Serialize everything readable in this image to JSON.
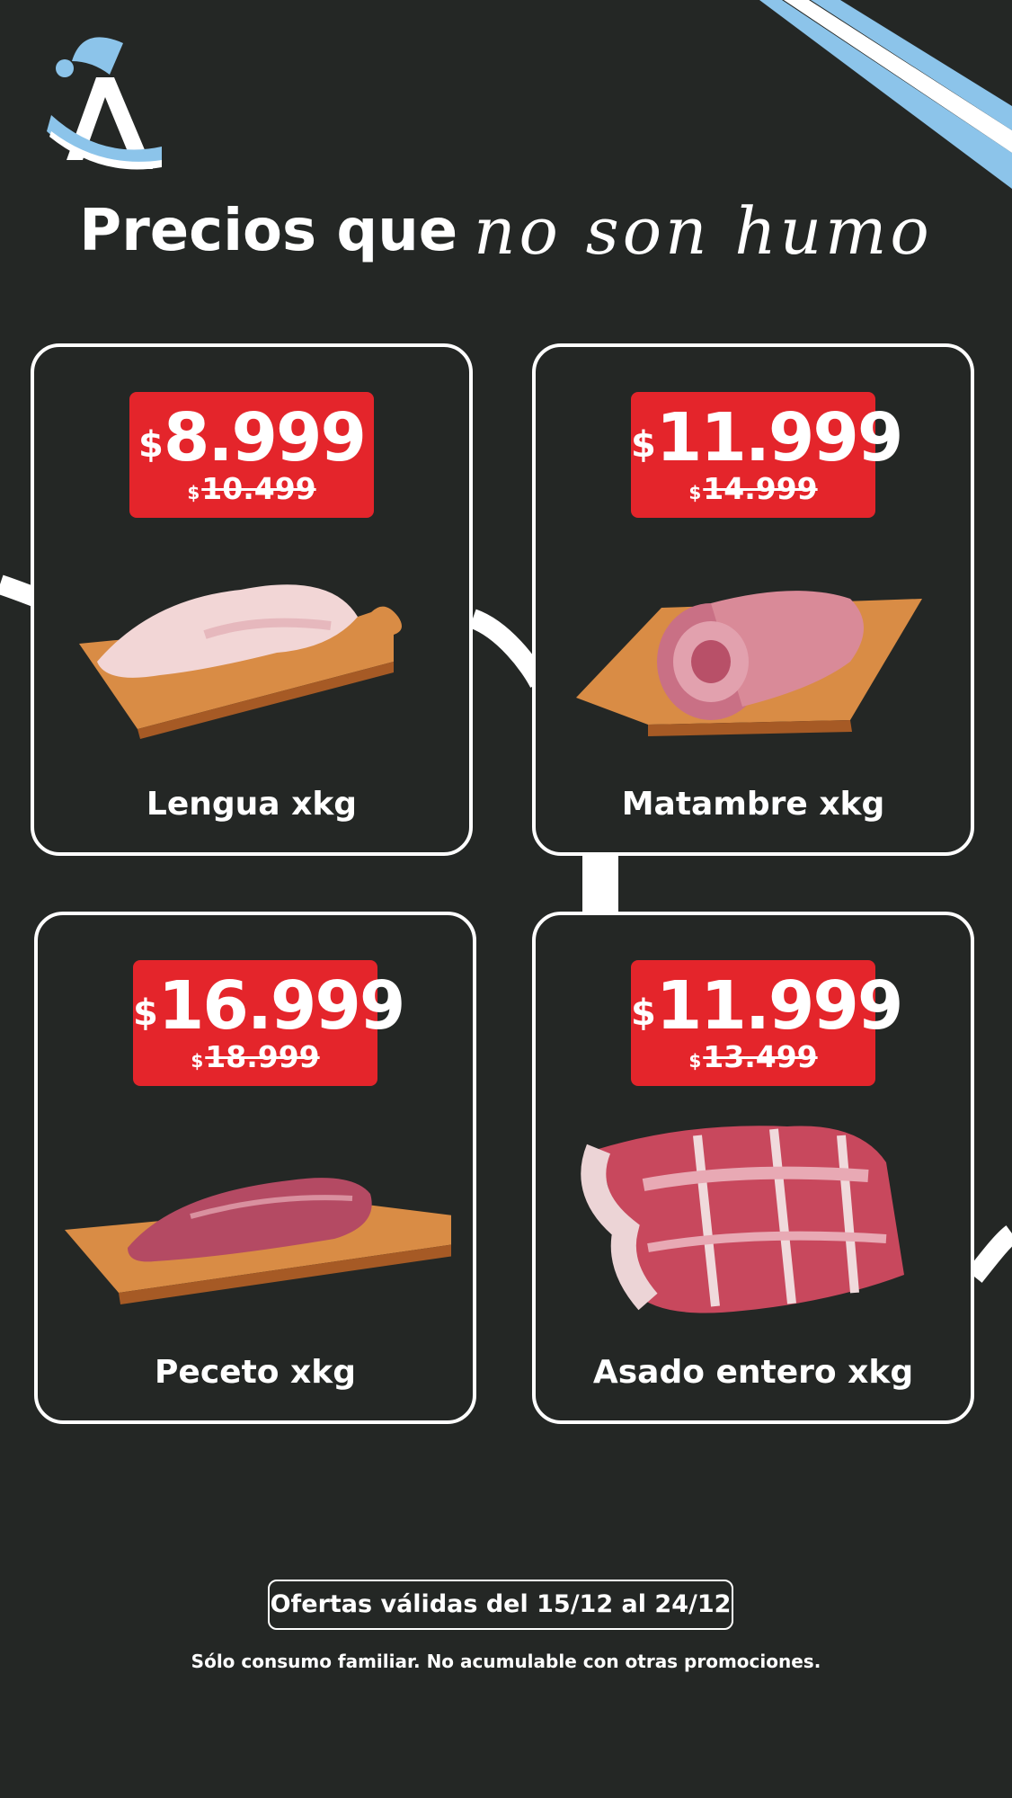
{
  "colors": {
    "background": "#242725",
    "price_red": "#e4252b",
    "flag_blue": "#8cc4ea",
    "board_wood": "#d98c45",
    "text": "#ffffff"
  },
  "header": {
    "logo_icon": "brand-logo-icon",
    "title_plain": "Precios que",
    "title_script": "no son humo"
  },
  "products": [
    {
      "name": "Lengua xkg",
      "currency": "$",
      "price": "8.999",
      "old_currency": "$",
      "old_price": "10.499",
      "image": "beef-tongue-image"
    },
    {
      "name": "Matambre xkg",
      "currency": "$",
      "price": "11.999",
      "old_currency": "$",
      "old_price": "14.999",
      "image": "rolled-matambre-image"
    },
    {
      "name": "Peceto xkg",
      "currency": "$",
      "price": "16.999",
      "old_currency": "$",
      "old_price": "18.999",
      "image": "peceto-cut-image"
    },
    {
      "name": "Asado entero xkg",
      "currency": "$",
      "price": "11.999",
      "old_currency": "$",
      "old_price": "13.499",
      "image": "asado-ribs-image"
    }
  ],
  "footer": {
    "validity": "Ofertas válidas del 15/12 al 24/12",
    "disclaimer": "Sólo consumo familiar. No acumulable con otras promociones."
  }
}
